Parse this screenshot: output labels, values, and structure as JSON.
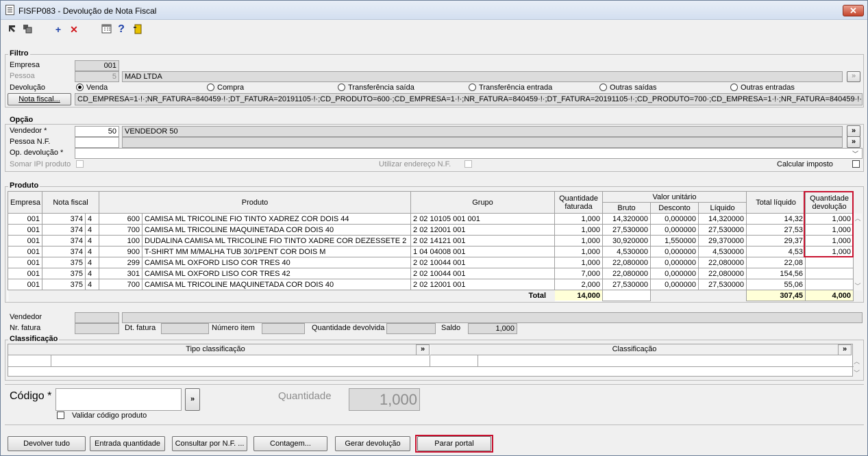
{
  "window": {
    "title": "FISFP083 - Devolução de Nota Fiscal",
    "close": "✕"
  },
  "filtro": {
    "legend": "Filtro",
    "empresa_label": "Empresa",
    "empresa_value": "001",
    "pessoa_label": "Pessoa",
    "pessoa_code": "5",
    "pessoa_name": "MAD LTDA",
    "devolucao_label": "Devolução",
    "radios": [
      "Venda",
      "Compra",
      "Transferência saída",
      "Transferência entrada",
      "Outras saídas",
      "Outras entradas"
    ],
    "nota_fiscal_button": "Nota fiscal...",
    "nota_fiscal_value": "CD_EMPRESA=1·!·;NR_FATURA=840459·!·;DT_FATURA=20191105·!·;CD_PRODUTO=600·;CD_EMPRESA=1·!·;NR_FATURA=840459·!·;DT_FATURA=20191105·!·;CD_PRODUTO=700·;CD_EMPRESA=1·!·;NR_FATURA=840459·!·;DT_FATURA=2"
  },
  "opcao": {
    "legend": "Opção",
    "vendedor_label": "Vendedor *",
    "vendedor_code": "50",
    "vendedor_name": "VENDEDOR 50",
    "pessoa_nf_label": "Pessoa N.F.",
    "op_devolucao_label": "Op. devolução *",
    "somar_ipi_label": "Somar IPI produto",
    "utilizar_endereco_label": "Utilizar endereço N.F.",
    "calcular_imposto_label": "Calcular imposto",
    "arrow": "»"
  },
  "produto": {
    "legend": "Produto",
    "headers": {
      "empresa": "Empresa",
      "nota_fiscal": "Nota fiscal",
      "produto": "Produto",
      "grupo": "Grupo",
      "qtd_faturada_1": "Quantidade",
      "qtd_faturada_2": "faturada",
      "valor_unitario": "Valor unitário",
      "bruto": "Bruto",
      "desconto": "Desconto",
      "liquido": "Líquido",
      "total_liquido": "Total líquido",
      "qtd_devolucao_1": "Quantidade",
      "qtd_devolucao_2": "devolução"
    },
    "rows": [
      {
        "empresa": "001",
        "nf": "374",
        "seq": "4",
        "cod": "600",
        "desc": "CAMISA ML TRICOLINE FIO TINTO XADREZ COR DOIS 44",
        "grupo": "2 02 10105 001 001",
        "qtd": "1,000",
        "bruto": "14,320000",
        "desconto": "0,000000",
        "liquido": "14,320000",
        "total": "14,32",
        "dev": "1,000"
      },
      {
        "empresa": "001",
        "nf": "374",
        "seq": "4",
        "cod": "700",
        "desc": "CAMISA ML TRICOLINE MAQUINETADA COR DOIS 40",
        "grupo": "2 02 12001 001",
        "qtd": "1,000",
        "bruto": "27,530000",
        "desconto": "0,000000",
        "liquido": "27,530000",
        "total": "27,53",
        "dev": "1,000"
      },
      {
        "empresa": "001",
        "nf": "374",
        "seq": "4",
        "cod": "100",
        "desc": "DUDALINA CAMISA ML TRICOLINE FIO TINTO XADRE COR DEZESSETE 2",
        "grupo": "2 02 14121 001",
        "qtd": "1,000",
        "bruto": "30,920000",
        "desconto": "1,550000",
        "liquido": "29,370000",
        "total": "29,37",
        "dev": "1,000"
      },
      {
        "empresa": "001",
        "nf": "374",
        "seq": "4",
        "cod": "900",
        "desc": "T-SHIRT MM M/MALHA TUB 30/1PENT COR DOIS M",
        "grupo": "1 04 04008 001",
        "qtd": "1,000",
        "bruto": "4,530000",
        "desconto": "0,000000",
        "liquido": "4,530000",
        "total": "4,53",
        "dev": "1,000"
      },
      {
        "empresa": "001",
        "nf": "375",
        "seq": "4",
        "cod": "299",
        "desc": "CAMISA ML OXFORD LISO COR TRES 40",
        "grupo": "2 02 10044 001",
        "qtd": "1,000",
        "bruto": "22,080000",
        "desconto": "0,000000",
        "liquido": "22,080000",
        "total": "22,08",
        "dev": ""
      },
      {
        "empresa": "001",
        "nf": "375",
        "seq": "4",
        "cod": "301",
        "desc": "CAMISA ML OXFORD LISO COR TRES 42",
        "grupo": "2 02 10044 001",
        "qtd": "7,000",
        "bruto": "22,080000",
        "desconto": "0,000000",
        "liquido": "22,080000",
        "total": "154,56",
        "dev": ""
      },
      {
        "empresa": "001",
        "nf": "375",
        "seq": "4",
        "cod": "700",
        "desc": "CAMISA ML TRICOLINE MAQUINETADA COR DOIS 40",
        "grupo": "2 02 12001 001",
        "qtd": "2,000",
        "bruto": "27,530000",
        "desconto": "0,000000",
        "liquido": "27,530000",
        "total": "55,06",
        "dev": ""
      }
    ],
    "total_label": "Total",
    "total_qtd": "14,000",
    "total_liquido": "307,45",
    "total_dev": "4,000"
  },
  "detalhe": {
    "vendedor_label": "Vendedor",
    "nr_fatura_label": "Nr. fatura",
    "dt_fatura_label": "Dt. fatura",
    "numero_item_label": "Número item",
    "qtd_devolvida_label": "Quantidade devolvida",
    "saldo_label": "Saldo",
    "saldo_value": "1,000"
  },
  "classificacao": {
    "legend": "Classificação",
    "tipo_header": "Tipo classificação",
    "classificacao_header": "Classificação"
  },
  "codigo": {
    "label": "Código *",
    "quantidade_label": "Quantidade",
    "quantidade_value": "1,000",
    "validar_label": "Validar código produto"
  },
  "buttons": {
    "devolver_tudo": "Devolver tudo",
    "entrada_quantidade": "Entrada quantidade",
    "consultar_nf": "Consultar por N.F. ...",
    "contagem": "Contagem...",
    "gerar_devolucao": "Gerar devolução",
    "parar_portal": "Parar portal"
  },
  "colors": {
    "highlight": "#c8102e",
    "total_bg": "#ffffd8"
  }
}
